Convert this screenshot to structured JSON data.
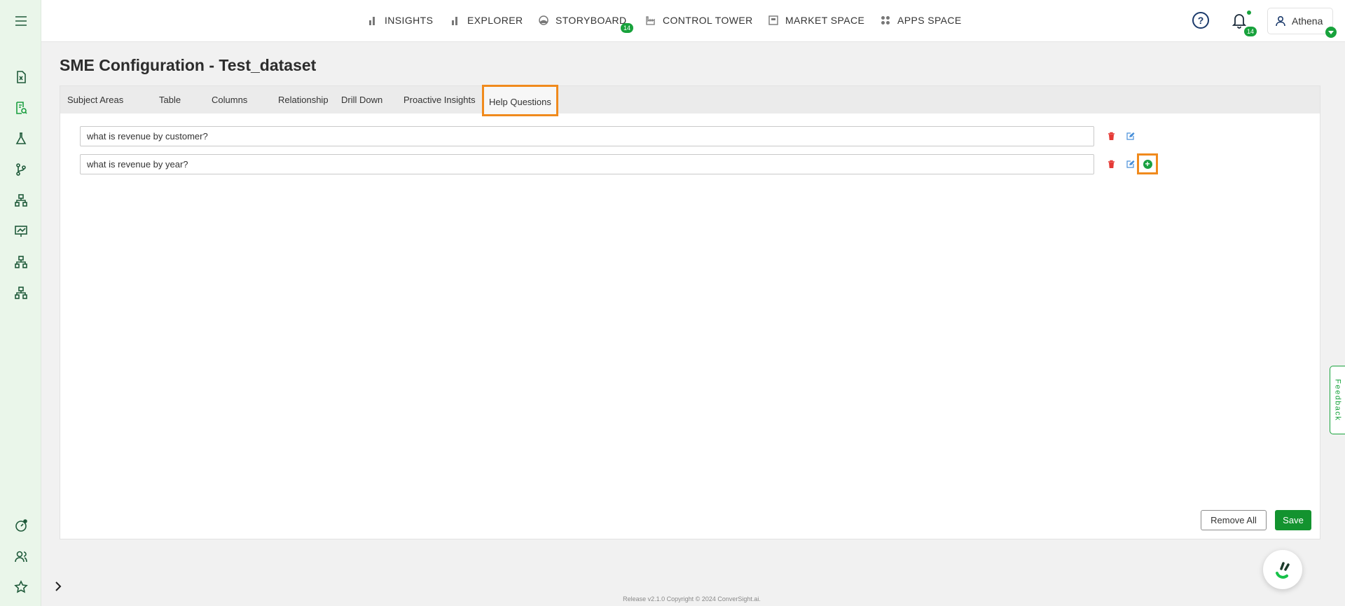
{
  "topbar": {
    "nav": [
      {
        "label": "INSIGHTS",
        "icon": "bar-chart-icon"
      },
      {
        "label": "EXPLORER",
        "icon": "bar-chart-icon"
      },
      {
        "label": "STORYBOARD",
        "icon": "storyboard-icon",
        "badge": "14"
      },
      {
        "label": "CONTROL TOWER",
        "icon": "factory-icon"
      },
      {
        "label": "MARKET SPACE",
        "icon": "market-icon"
      },
      {
        "label": "APPS SPACE",
        "icon": "grid-icon"
      }
    ],
    "help_icon": "question-circle-icon",
    "notifications_badge": "14",
    "user_name": "Athena"
  },
  "page_title": "SME Configuration - Test_dataset",
  "tabs": [
    {
      "label": "Subject Areas"
    },
    {
      "label": "Table"
    },
    {
      "label": "Columns"
    },
    {
      "label": "Relationship"
    },
    {
      "label": "Drill Down"
    },
    {
      "label": "Proactive Insights"
    },
    {
      "label": "Help Questions",
      "active": true
    }
  ],
  "questions": [
    {
      "value": "what is revenue by customer?"
    },
    {
      "value": "what is revenue by year?"
    }
  ],
  "buttons": {
    "remove_all": "Remove All",
    "save": "Save"
  },
  "feedback_label": "Feedback",
  "footer_text": "Release v2.1.0 Copyright © 2024 ConverSight.ai.",
  "colors": {
    "accent_green": "#18a23c",
    "highlight_orange": "#f08a1d",
    "delete_red": "#e53935",
    "edit_blue": "#4a90d9"
  }
}
